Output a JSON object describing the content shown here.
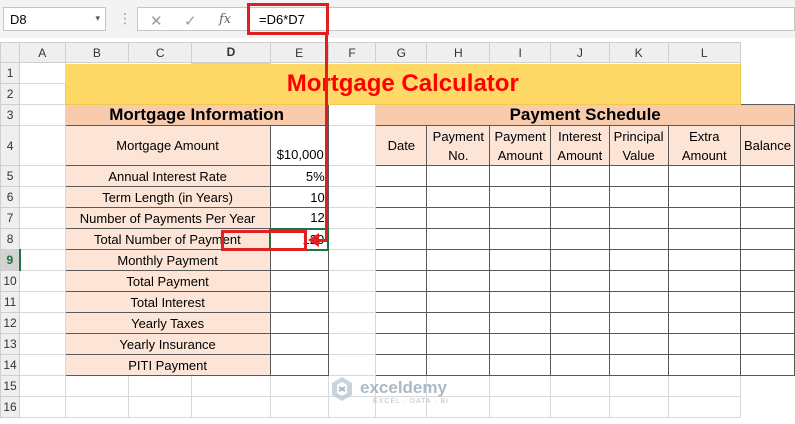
{
  "formula_bar": {
    "name_box": "D8",
    "name_box_arrow": "▾",
    "separator": "⋮",
    "cancel_icon": "✕",
    "enter_icon": "✓",
    "fx_label": "fx",
    "formula": "=D6*D7"
  },
  "columns": [
    "A",
    "B",
    "C",
    "D",
    "E",
    "F",
    "G",
    "H",
    "I",
    "J",
    "K",
    "L"
  ],
  "rows": [
    "1",
    "2",
    "3",
    "4",
    "5",
    "6",
    "7",
    "8",
    "9",
    "10",
    "11",
    "12",
    "13",
    "14",
    "15",
    "16"
  ],
  "sheet": {
    "title": "Mortgage Calculator",
    "mortgage_info": {
      "heading": "Mortgage Information",
      "amount_label": "Mortgage Amount",
      "amount_currency": "$",
      "amount_value": "10,000",
      "items": [
        {
          "label": "Annual Interest Rate",
          "value": "5%"
        },
        {
          "label": "Term Length (in Years)",
          "value": "10"
        },
        {
          "label": "Number of Payments Per Year",
          "value": "12"
        },
        {
          "label": "Total Number of Payment",
          "value": "120"
        },
        {
          "label": "Monthly Payment",
          "value": ""
        },
        {
          "label": "Total Payment",
          "value": ""
        },
        {
          "label": "Total Interest",
          "value": ""
        },
        {
          "label": "Yearly Taxes",
          "value": ""
        },
        {
          "label": "Yearly Insurance",
          "value": ""
        },
        {
          "label": "PITI Payment",
          "value": ""
        }
      ]
    },
    "payment_schedule": {
      "heading": "Payment Schedule",
      "headers": [
        "Date",
        "Payment No.",
        "Payment Amount",
        "Interest Amount",
        "Principal Value",
        "Extra Amount",
        "Balance"
      ]
    }
  },
  "watermark": {
    "name": "exceldemy",
    "tagline": "EXCEL · DATA · BI"
  },
  "colors": {
    "title_fill": "#ffd966",
    "title_text": "#ff0000",
    "section_fill": "#f8cbad",
    "label_fill": "#fce4d6",
    "annotation": "#e02020",
    "selection": "#217346"
  }
}
